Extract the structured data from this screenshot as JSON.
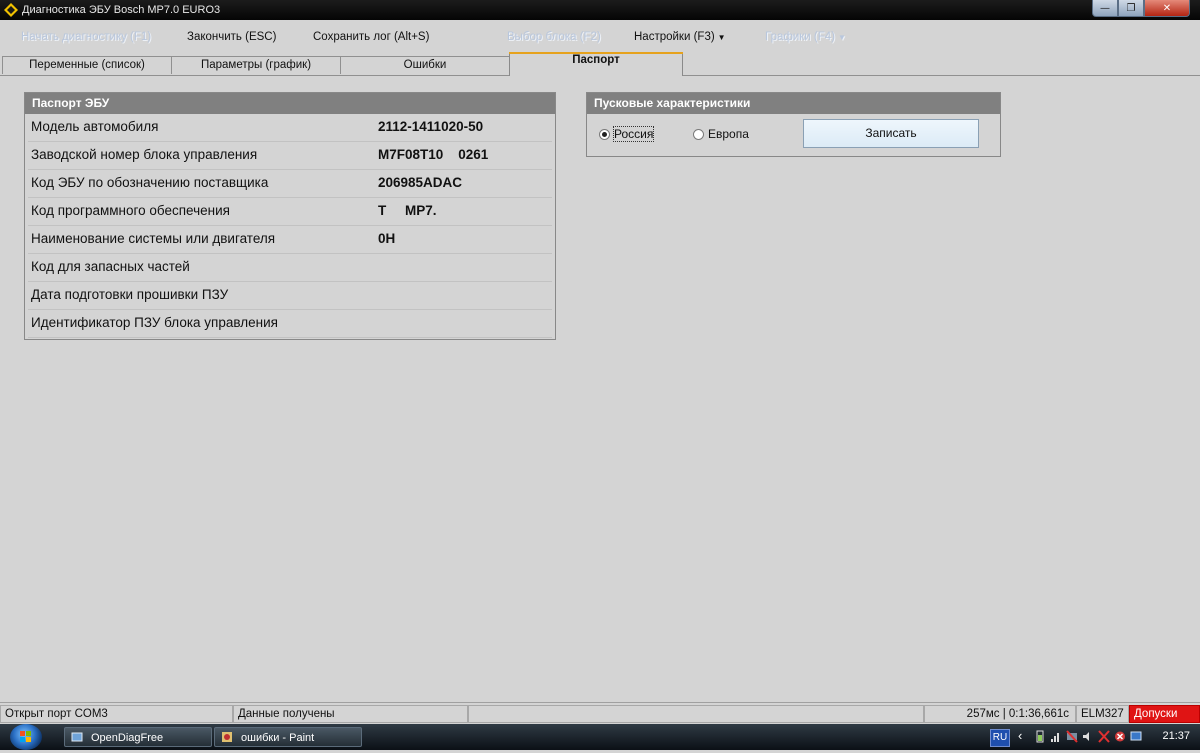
{
  "window": {
    "title": "Диагностика ЭБУ Bosch MP7.0 EURO3",
    "min_glyph": "—",
    "restore_glyph": "❐",
    "close_glyph": "✕"
  },
  "menu": {
    "start_diag": "Начать диагностику (F1)",
    "finish": "Закончить (ESC)",
    "save_log": "Сохранить лог (Alt+S)",
    "select_block": "Выбор блока (F2)",
    "settings": "Настройки (F3)",
    "graphs": "Графики (F4)",
    "caret": "▼"
  },
  "tabs": {
    "variables": "Переменные (список)",
    "params_graph": "Параметры (график)",
    "errors": "Ошибки",
    "passport": "Паспорт"
  },
  "passport_panel": {
    "title": "Паспорт ЭБУ",
    "rows": [
      {
        "label": "Модель автомобиля",
        "value": "2112-1411020-50"
      },
      {
        "label": "Заводской номер блока управления",
        "value": "M7F08T10    0261"
      },
      {
        "label": "Код ЭБУ по обозначению поставщика",
        "value": "206985ADAC"
      },
      {
        "label": "Код программного обеспечения",
        "value": "T     MP7."
      },
      {
        "label": "Наименование системы или двигателя",
        "value": "0H"
      },
      {
        "label": "Код для запасных частей",
        "value": ""
      },
      {
        "label": "Дата подготовки прошивки ПЗУ",
        "value": ""
      },
      {
        "label": "Идентификатор ПЗУ блока управления",
        "value": ""
      }
    ]
  },
  "startup_panel": {
    "title": "Пусковые характеристики",
    "radio_russia": "Россия",
    "radio_europe": "Европа",
    "selected": "Россия",
    "write_button": "Записать"
  },
  "statusbar": {
    "port": "Открыт порт COM3",
    "data": "Данные получены",
    "empty": "",
    "timing": "257мс | 0:1:36,661с",
    "adapter": "ELM327",
    "tolerances": "Допуски"
  },
  "taskbar": {
    "task1": "OpenDiagFree",
    "task2": "ошибки - Paint",
    "lang": "RU",
    "chevron": "‹",
    "clock": "21:37"
  },
  "colors": {
    "background": "#d4d4d4",
    "panel_header": "#808080",
    "status_red": "#e01414",
    "disabled_menu": "#b9c7dd"
  }
}
